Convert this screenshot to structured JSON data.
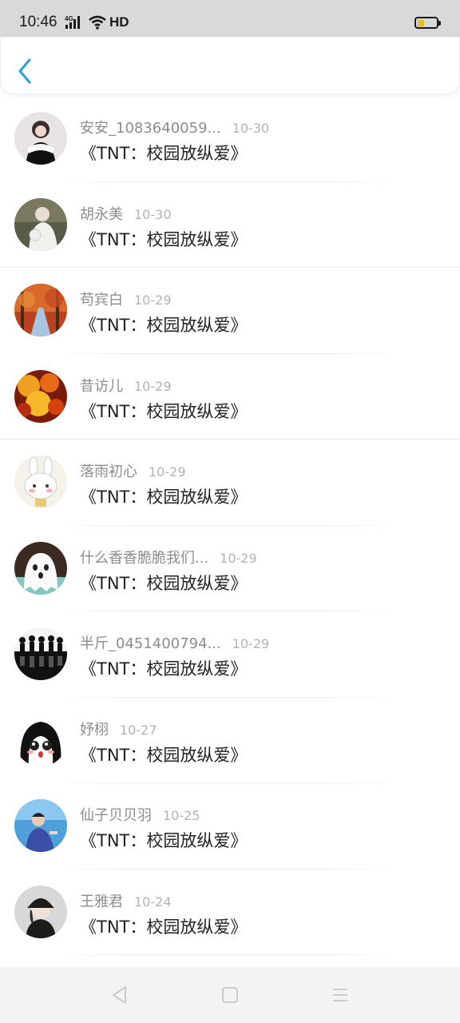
{
  "status_bar": {
    "time": "10:46",
    "network_label": "4G",
    "hd_label": "HD",
    "battery_level": 0.35,
    "battery_color": "#e6c200"
  },
  "header": {
    "back_icon": "chevron-left-icon",
    "accent_color": "#2a9fd6"
  },
  "items": [
    {
      "name": "安安_1083640059...",
      "date": "10-30",
      "title": "《TNT：校园放纵爱》",
      "avatar": "avatar-girl-white-dress"
    },
    {
      "name": "胡永美",
      "date": "10-30",
      "title": "《TNT：校园放纵爱》",
      "avatar": "avatar-girl-white-coat"
    },
    {
      "name": "苟宾白",
      "date": "10-29",
      "title": "《TNT：校园放纵爱》",
      "avatar": "avatar-autumn-forest"
    },
    {
      "name": "昔访儿",
      "date": "10-29",
      "title": "《TNT：校园放纵爱》",
      "avatar": "avatar-orange-leaves"
    },
    {
      "name": "落雨初心",
      "date": "10-29",
      "title": "《TNT：校园放纵爱》",
      "avatar": "avatar-cartoon-rabbit"
    },
    {
      "name": "什么香香脆脆我们...",
      "date": "10-29",
      "title": "《TNT：校园放纵爱》",
      "avatar": "avatar-cartoon-ghost"
    },
    {
      "name": "半斤_0451400794...",
      "date": "10-29",
      "title": "《TNT：校园放纵爱》",
      "avatar": "avatar-silhouettes"
    },
    {
      "name": "妤栩",
      "date": "10-27",
      "title": "《TNT：校园放纵爱》",
      "avatar": "avatar-anime-girl"
    },
    {
      "name": "仙子贝贝羽",
      "date": "10-25",
      "title": "《TNT：校园放纵爱》",
      "avatar": "avatar-boy-blue"
    },
    {
      "name": "王雅君",
      "date": "10-24",
      "title": "《TNT：校园放纵爱》",
      "avatar": "avatar-person-cap"
    }
  ],
  "nav_bar": {
    "back_icon": "triangle-back-icon",
    "home_icon": "square-home-icon",
    "menu_icon": "menu-lines-icon"
  }
}
